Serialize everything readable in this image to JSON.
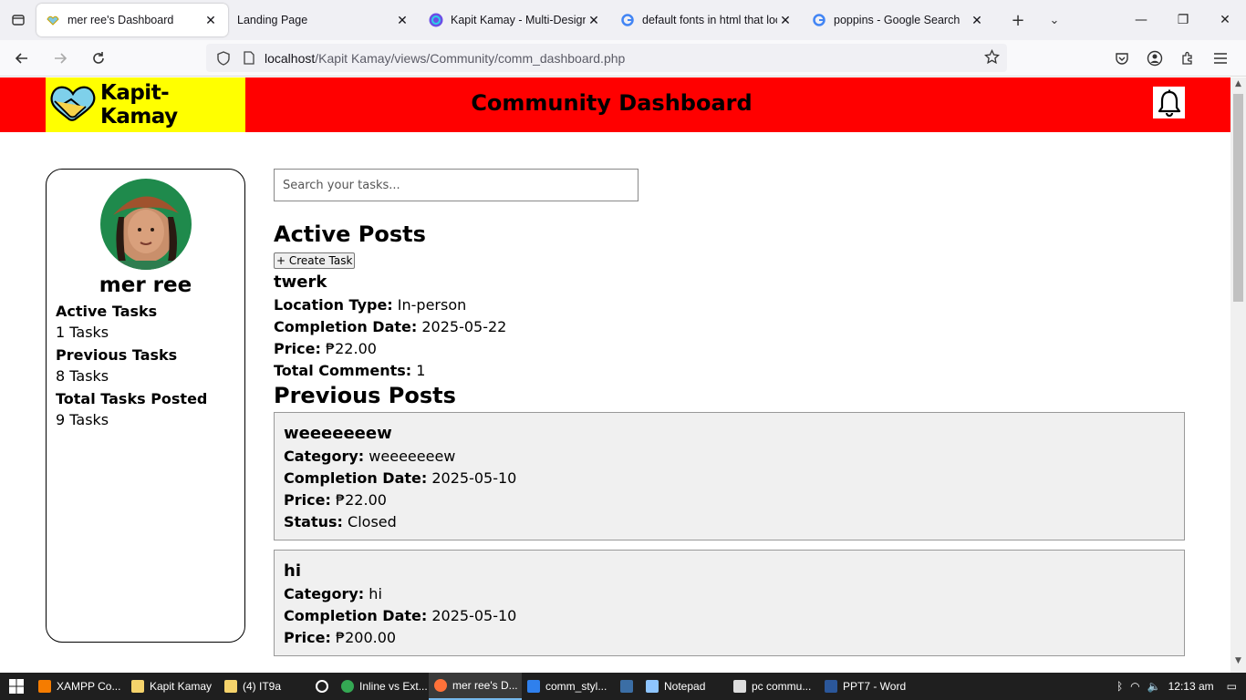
{
  "browser": {
    "tabs": [
      {
        "title": "mer ree's Dashboard",
        "active": true
      },
      {
        "title": "Landing Page",
        "active": false
      },
      {
        "title": "Kapit Kamay - Multi-Design -",
        "active": false
      },
      {
        "title": "default fonts in html that lool",
        "active": false
      },
      {
        "title": "poppins - Google Search",
        "active": false
      }
    ],
    "url_host": "localhost",
    "url_path": "/Kapit Kamay/views/Community/comm_dashboard.php"
  },
  "header": {
    "logo_text": "Kapit-Kamay",
    "title": "Community Dashboard"
  },
  "profile": {
    "name": "mer ree",
    "stats": [
      {
        "label": "Active Tasks",
        "value": "1 Tasks"
      },
      {
        "label": "Previous Tasks",
        "value": "8 Tasks"
      },
      {
        "label": "Total Tasks Posted",
        "value": "9 Tasks"
      }
    ]
  },
  "search": {
    "placeholder": "Search your tasks..."
  },
  "active_posts": {
    "title": "Active Posts",
    "create_label": "+ Create Task",
    "post": {
      "title": "twerk",
      "location_label": "Location Type:",
      "location": "In-person",
      "date_label": "Completion Date:",
      "date": "2025-05-22",
      "price_label": "Price:",
      "price": "₱22.00",
      "comments_label": "Total Comments:",
      "comments": "1"
    }
  },
  "previous_posts": {
    "title": "Previous Posts",
    "posts": [
      {
        "title": "weeeeeeew",
        "category_label": "Category:",
        "category": "weeeeeeew",
        "date_label": "Completion Date:",
        "date": "2025-05-10",
        "price_label": "Price:",
        "price": "₱22.00",
        "status_label": "Status:",
        "status": "Closed"
      },
      {
        "title": "hi",
        "category_label": "Category:",
        "category": "hi",
        "date_label": "Completion Date:",
        "date": "2025-05-10",
        "price_label": "Price:",
        "price": "₱200.00"
      }
    ]
  },
  "taskbar": {
    "items": [
      "XAMPP Co...",
      "Kapit Kamay",
      "(4) IT9a",
      "",
      "Inline vs Ext...",
      "mer ree's D...",
      "comm_styl...",
      "",
      "Notepad",
      "pc commu...",
      "PPT7 - Word"
    ],
    "time": "12:13 am"
  },
  "colors": {
    "header_bg": "#ff0000",
    "logo_bg": "#ffff00"
  }
}
